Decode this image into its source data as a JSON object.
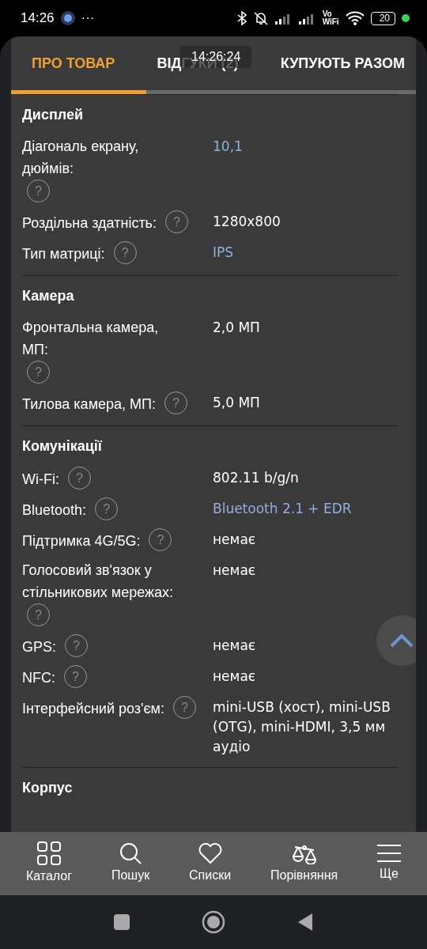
{
  "status_bar": {
    "time": "14:26",
    "more": "···",
    "battery": "20",
    "vowifi_top": "Vo",
    "vowifi_bottom": "WiFi"
  },
  "tabs": [
    {
      "label": "ПРО ТОВАР",
      "selected": true
    },
    {
      "label": "ВІДГУКИ (2)",
      "selected": false
    },
    {
      "label": "КУПУЮТЬ РАЗОМ",
      "selected": false
    }
  ],
  "timestamp_overlay": "14:26:24",
  "sections": [
    {
      "title": "Дисплей",
      "rows": [
        {
          "label": "Діагональ екрану, дюймів:",
          "value": "10,1",
          "link": true
        },
        {
          "label": "Роздільна здатність:",
          "value": "1280x800",
          "link": false
        },
        {
          "label": "Тип матриці:",
          "value": "IPS",
          "link": true
        }
      ]
    },
    {
      "title": "Камера",
      "rows": [
        {
          "label": "Фронтальна камера, МП:",
          "value": "2,0 МП",
          "link": false
        },
        {
          "label": "Тилова камера, МП:",
          "value": "5,0 МП",
          "link": false
        }
      ]
    },
    {
      "title": "Комунікації",
      "rows": [
        {
          "label": "Wi-Fi:",
          "value": "802.11 b/g/n",
          "link": false
        },
        {
          "label": "Bluetooth:",
          "value": "Bluetooth 2.1 + EDR",
          "link": true
        },
        {
          "label": "Підтримка 4G/5G:",
          "value": "немає",
          "link": false
        },
        {
          "label": "Голосовий зв'язок у стільникових мережах:",
          "value": "немає",
          "link": false
        },
        {
          "label": "GPS:",
          "value": "немає",
          "link": false
        },
        {
          "label": "NFC:",
          "value": "немає",
          "link": false
        },
        {
          "label": "Інтерфейсний роз'єм:",
          "value": "mini-USB (хост), mini-USB (OTG), mini-HDMI, 3,5 мм аудіо",
          "link": false
        }
      ]
    },
    {
      "title": "Корпус"
    }
  ],
  "help_mark": "?",
  "bottom_nav": [
    {
      "kind": "grid",
      "label": "Каталог"
    },
    {
      "kind": "search",
      "label": "Пошук"
    },
    {
      "kind": "heart",
      "label": "Списки"
    },
    {
      "kind": "scales",
      "label": "Порівняння"
    },
    {
      "kind": "menu",
      "label": "Ще"
    }
  ]
}
